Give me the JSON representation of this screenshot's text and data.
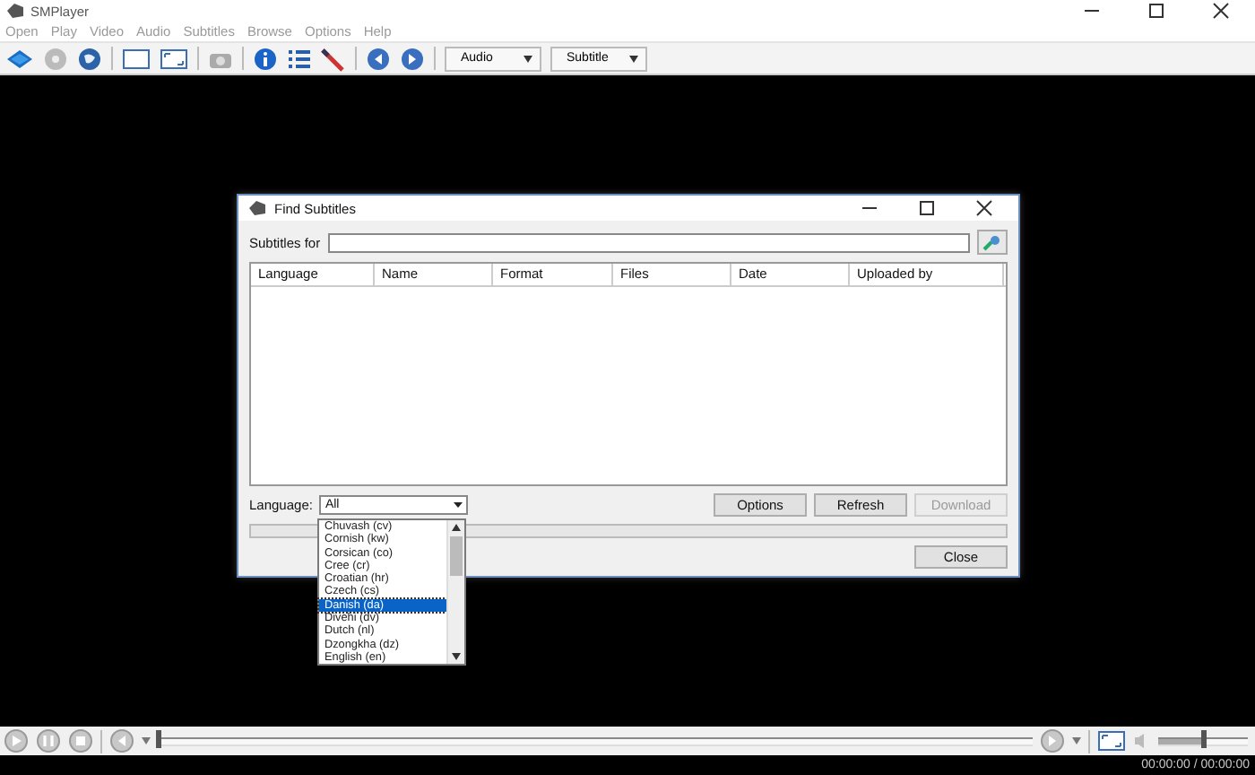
{
  "window": {
    "title": "SMPlayer"
  },
  "menu": [
    "Open",
    "Play",
    "Video",
    "Audio",
    "Subtitles",
    "Browse",
    "Options",
    "Help"
  ],
  "toolbar": {
    "dropdowns": [
      "Audio",
      "Subtitle"
    ]
  },
  "dialog": {
    "title": "Find Subtitles",
    "search_label": "Subtitles for",
    "columns": [
      "Language",
      "Name",
      "Format",
      "Files",
      "Date",
      "Uploaded by"
    ],
    "language": {
      "label": "Language:",
      "value": "All",
      "options": [
        {
          "label": "Chuvash (cv)",
          "selected": false
        },
        {
          "label": "Cornish (kw)",
          "selected": false
        },
        {
          "label": "Corsican (co)",
          "selected": false
        },
        {
          "label": "Cree (cr)",
          "selected": false
        },
        {
          "label": "Croatian (hr)",
          "selected": false
        },
        {
          "label": "Czech (cs)",
          "selected": false
        },
        {
          "label": "Danish (da)",
          "selected": true
        },
        {
          "label": "Divehi (dv)",
          "selected": false
        },
        {
          "label": "Dutch (nl)",
          "selected": false
        },
        {
          "label": "Dzongkha (dz)",
          "selected": false
        },
        {
          "label": "English (en)",
          "selected": false
        }
      ]
    },
    "buttons": [
      {
        "label": "Options",
        "disabled": false
      },
      {
        "label": "Refresh",
        "disabled": false
      },
      {
        "label": "Download",
        "disabled": true
      }
    ],
    "progress": {
      "level": 0
    },
    "close_button": "Close"
  },
  "player": {
    "seek": {
      "level": 0
    },
    "volume": {
      "level": 0.5
    },
    "time": "00:00:00 / 00:00:00"
  }
}
